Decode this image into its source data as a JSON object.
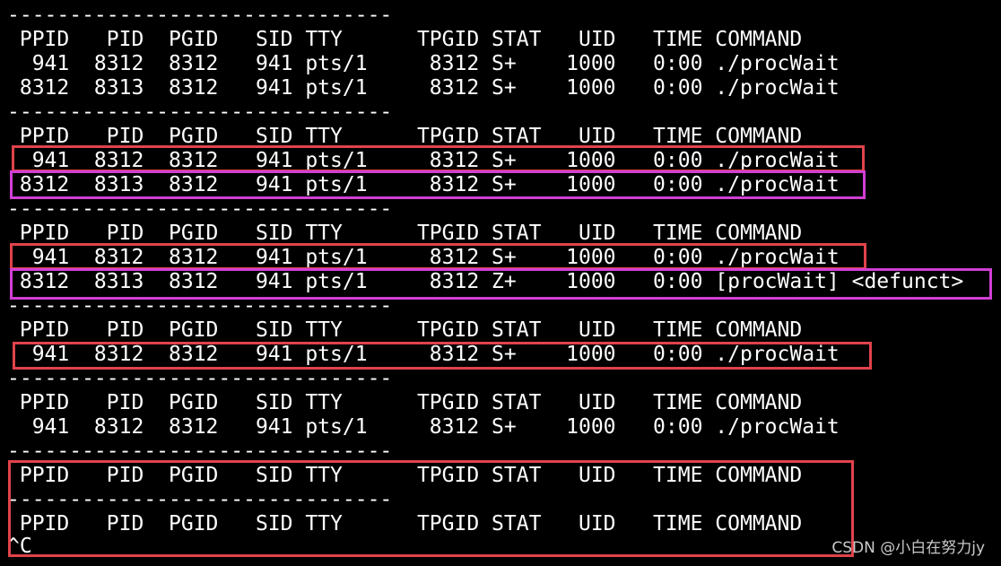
{
  "terminal": {
    "lines": [
      "-------------------------------",
      " PPID   PID  PGID   SID TTY      TPGID STAT   UID   TIME COMMAND",
      "  941  8312  8312   941 pts/1     8312 S+    1000   0:00 ./procWait",
      " 8312  8313  8312   941 pts/1     8312 S+    1000   0:00 ./procWait",
      "-------------------------------",
      " PPID   PID  PGID   SID TTY      TPGID STAT   UID   TIME COMMAND",
      "  941  8312  8312   941 pts/1     8312 S+    1000   0:00 ./procWait",
      " 8312  8313  8312   941 pts/1     8312 S+    1000   0:00 ./procWait",
      "-------------------------------",
      " PPID   PID  PGID   SID TTY      TPGID STAT   UID   TIME COMMAND",
      "  941  8312  8312   941 pts/1     8312 S+    1000   0:00 ./procWait",
      " 8312  8313  8312   941 pts/1     8312 Z+    1000   0:00 [procWait] <defunct>",
      "-------------------------------",
      " PPID   PID  PGID   SID TTY      TPGID STAT   UID   TIME COMMAND",
      "  941  8312  8312   941 pts/1     8312 S+    1000   0:00 ./procWait",
      "-------------------------------",
      " PPID   PID  PGID   SID TTY      TPGID STAT   UID   TIME COMMAND",
      "  941  8312  8312   941 pts/1     8312 S+    1000   0:00 ./procWait",
      "-------------------------------",
      " PPID   PID  PGID   SID TTY      TPGID STAT   UID   TIME COMMAND",
      "-------------------------------",
      " PPID   PID  PGID   SID TTY      TPGID STAT   UID   TIME COMMAND",
      "^C"
    ]
  },
  "highlight_colors": {
    "red": "#e0434b",
    "magenta": "#d03fd3"
  },
  "watermark": "CSDN @小白在努力jy"
}
